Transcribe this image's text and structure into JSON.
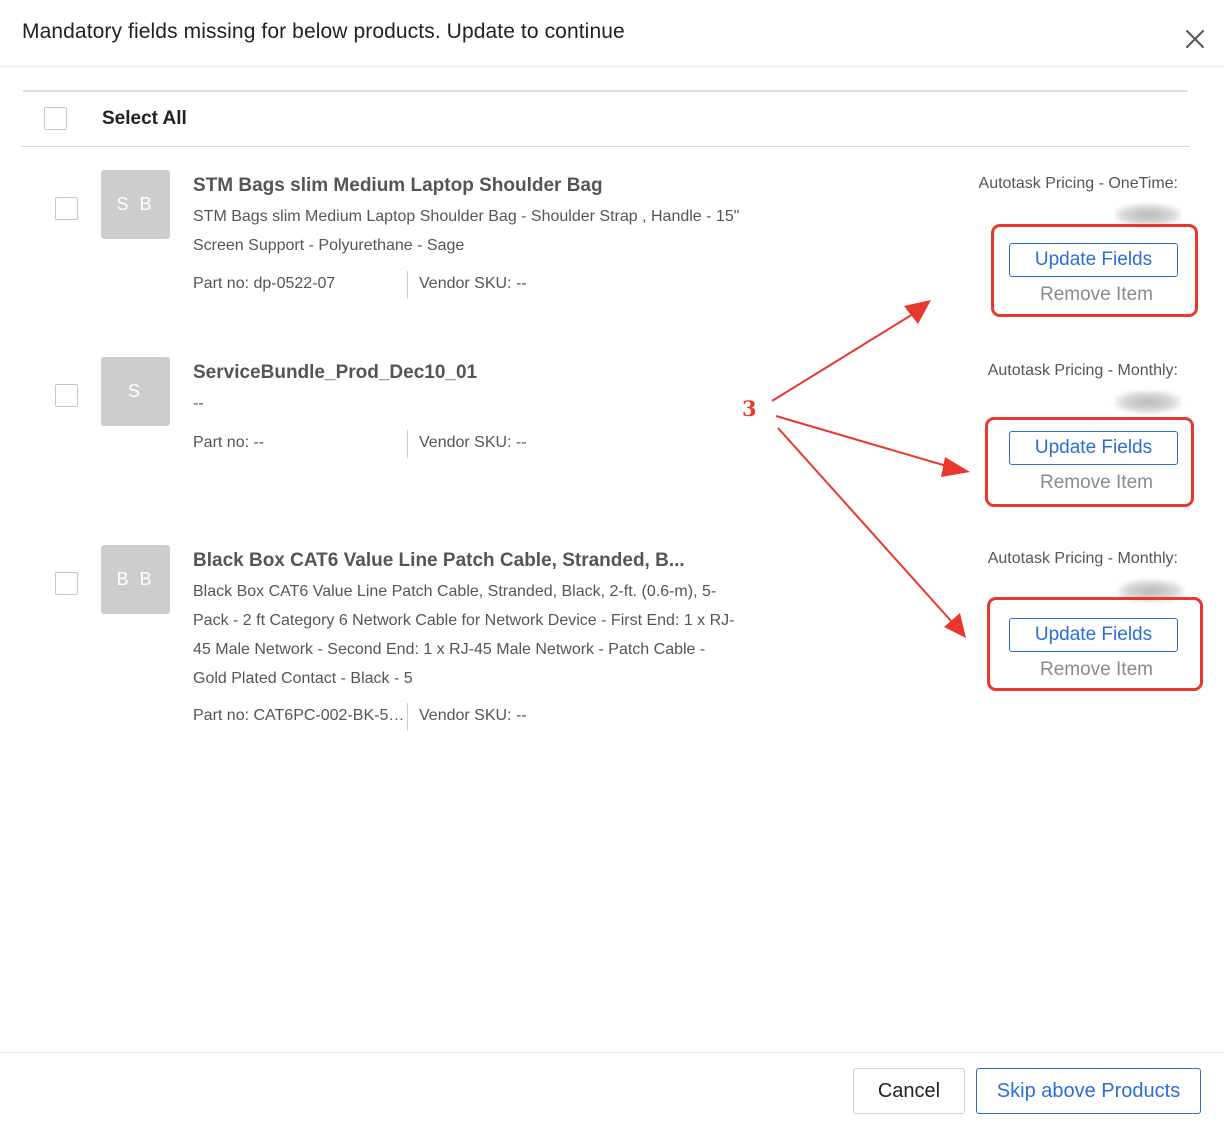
{
  "modal": {
    "title": "Mandatory fields missing for below products. Update to continue",
    "close_icon": "close-icon"
  },
  "select_all": {
    "label": "Select All",
    "checked": false
  },
  "products": [
    {
      "avatar": "S B",
      "name": "STM Bags slim Medium Laptop Shoulder Bag",
      "description": "STM Bags slim Medium Laptop Shoulder Bag - Shoulder Strap , Handle - 15\" Screen Support - Polyurethane - Sage",
      "part_no": "Part no: dp-0522-07",
      "vendor_sku": "Vendor SKU: --",
      "pricing_label": "Autotask Pricing - OneTime:",
      "update_label": "Update Fields",
      "remove_label": "Remove Item"
    },
    {
      "avatar": "S",
      "name": "ServiceBundle_Prod_Dec10_01",
      "description": "--",
      "part_no": "Part no: --",
      "vendor_sku": "Vendor SKU: --",
      "pricing_label": "Autotask Pricing - Monthly:",
      "update_label": "Update Fields",
      "remove_label": "Remove Item"
    },
    {
      "avatar": "B B",
      "name": "Black Box CAT6 Value Line Patch Cable, Stranded, B...",
      "description": "Black Box CAT6 Value Line Patch Cable, Stranded, Black, 2-ft. (0.6-m), 5-Pack - 2 ft Category 6 Network Cable for Network Device - First End: 1 x RJ-45 Male Network - Second End: 1 x RJ-45 Male Network - Patch Cable - Gold Plated Contact - Black - 5",
      "part_no": "Part no: CAT6PC-002-BK-5…",
      "vendor_sku": "Vendor SKU: --",
      "pricing_label": "Autotask Pricing - Monthly:",
      "update_label": "Update Fields",
      "remove_label": "Remove Item"
    }
  ],
  "annotation": {
    "number": "3",
    "color": "#e8372c"
  },
  "footer": {
    "cancel_label": "Cancel",
    "skip_label": "Skip above Products"
  },
  "colors": {
    "accent": "#2b6fd4",
    "annotation": "#e8372c",
    "avatar_bg": "#cdcdcd"
  }
}
